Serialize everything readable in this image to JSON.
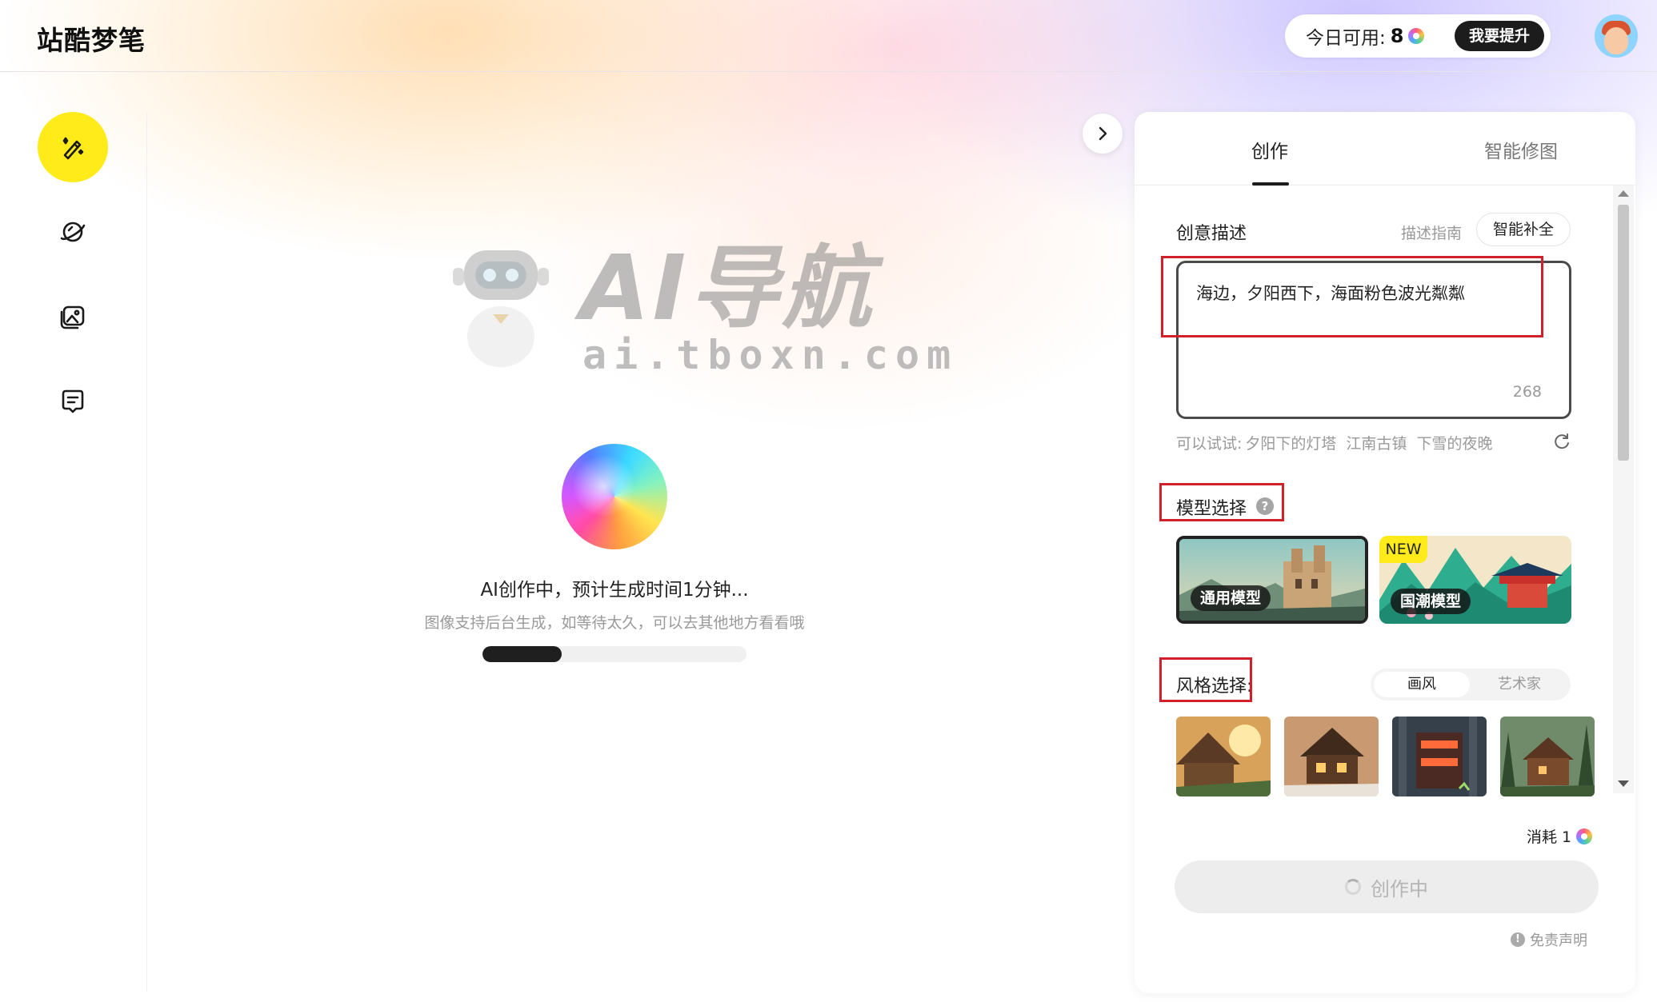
{
  "app": {
    "logo_text": "站酷梦笔"
  },
  "header": {
    "quota_label": "今日可用:",
    "quota_value": "8",
    "upgrade_label": "我要提升"
  },
  "sidebar": {
    "items": [
      {
        "name": "create",
        "icon": "magic-pen-icon",
        "active": true
      },
      {
        "name": "explore",
        "icon": "planet-icon",
        "active": false
      },
      {
        "name": "gallery",
        "icon": "images-icon",
        "active": false
      },
      {
        "name": "feedback",
        "icon": "chat-icon",
        "active": false
      }
    ],
    "accent_color": "#ffeb1a"
  },
  "watermark": {
    "title": "AI导航",
    "url": "ai.tboxn.com"
  },
  "generating": {
    "title": "AI创作中，预计生成时间1分钟...",
    "subtitle": "图像支持后台生成，如等待太久，可以去其他地方看看哦",
    "progress": 0.3
  },
  "panel": {
    "tabs": [
      {
        "label": "创作",
        "active": true
      },
      {
        "label": "智能修图",
        "active": false
      }
    ],
    "description": {
      "label": "创意描述",
      "guide_link": "描述指南",
      "smart_fill": "智能补全",
      "prompt": "海边，夕阳西下，海面粉色波光粼粼",
      "char_count": "268",
      "suggest_prefix": "可以试试:",
      "suggestions": [
        "夕阳下的灯塔",
        "江南古镇",
        "下雪的夜晚"
      ]
    },
    "model": {
      "label": "模型选择",
      "help": "?",
      "options": [
        {
          "label": "通用模型",
          "selected": true,
          "badge": ""
        },
        {
          "label": "国潮模型",
          "selected": false,
          "badge": "NEW"
        }
      ]
    },
    "style": {
      "label": "风格选择:",
      "segments": [
        "画风",
        "艺术家"
      ],
      "active_segment": "画风",
      "thumbnails": [
        "style-1",
        "style-2",
        "style-3",
        "style-4"
      ]
    },
    "cost_label": "消耗 1",
    "create_button": "创作中",
    "disclaimer": "免责声明",
    "disclaimer_icon": "!"
  }
}
